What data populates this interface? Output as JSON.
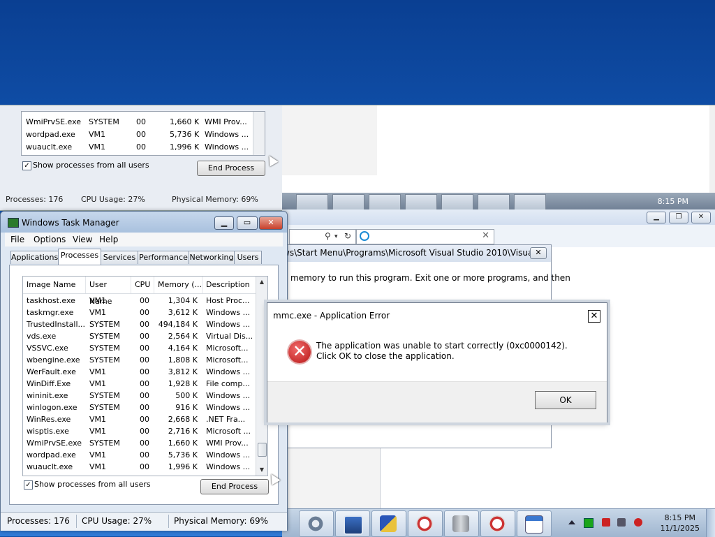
{
  "ghost": {
    "rows": [
      {
        "name": "WmiPrvSE.exe",
        "user": "SYSTEM",
        "cpu": "00",
        "mem": "1,660 K",
        "desc": "WMI Prov..."
      },
      {
        "name": "wordpad.exe",
        "user": "VM1",
        "cpu": "00",
        "mem": "5,736 K",
        "desc": "Windows ..."
      },
      {
        "name": "wuauclt.exe",
        "user": "VM1",
        "cpu": "00",
        "mem": "1,996 K",
        "desc": "Windows ..."
      }
    ],
    "show_all_label": "Show processes from all users",
    "end_process": "End Process",
    "status_processes": "Processes: 176",
    "status_cpu": "CPU Usage: 27%",
    "status_mem": "Physical Memory: 69%",
    "time": "8:15 PM"
  },
  "back_window": {
    "path_text": "ws\\Start Menu\\Programs\\Microsoft Visual Studio 2010\\Visual...",
    "message": "memory to run this program. Exit one or more programs, and then",
    "close": "✕"
  },
  "task_manager": {
    "title": "Windows Task Manager",
    "menu": [
      "File",
      "Options",
      "View",
      "Help"
    ],
    "tabs": [
      "Applications",
      "Processes",
      "Services",
      "Performance",
      "Networking",
      "Users"
    ],
    "active_tab": "Processes",
    "columns": [
      "Image Name",
      "User Name",
      "CPU",
      "Memory (...",
      "Description"
    ],
    "processes": [
      {
        "name": "taskhost.exe",
        "user": "VM1",
        "cpu": "00",
        "mem": "1,304 K",
        "desc": "Host Proc..."
      },
      {
        "name": "taskmgr.exe",
        "user": "VM1",
        "cpu": "00",
        "mem": "3,612 K",
        "desc": "Windows ..."
      },
      {
        "name": "TrustedInstall...",
        "user": "SYSTEM",
        "cpu": "00",
        "mem": "494,184 K",
        "desc": "Windows ..."
      },
      {
        "name": "vds.exe",
        "user": "SYSTEM",
        "cpu": "00",
        "mem": "2,564 K",
        "desc": "Virtual Dis..."
      },
      {
        "name": "VSSVC.exe",
        "user": "SYSTEM",
        "cpu": "00",
        "mem": "4,164 K",
        "desc": "Microsoft..."
      },
      {
        "name": "wbengine.exe",
        "user": "SYSTEM",
        "cpu": "00",
        "mem": "1,808 K",
        "desc": "Microsoft..."
      },
      {
        "name": "WerFault.exe",
        "user": "VM1",
        "cpu": "00",
        "mem": "3,812 K",
        "desc": "Windows ..."
      },
      {
        "name": "WinDiff.Exe",
        "user": "VM1",
        "cpu": "00",
        "mem": "1,928 K",
        "desc": "File comp..."
      },
      {
        "name": "wininit.exe",
        "user": "SYSTEM",
        "cpu": "00",
        "mem": "500 K",
        "desc": "Windows ..."
      },
      {
        "name": "winlogon.exe",
        "user": "SYSTEM",
        "cpu": "00",
        "mem": "916 K",
        "desc": "Windows ..."
      },
      {
        "name": "WinRes.exe",
        "user": "VM1",
        "cpu": "00",
        "mem": "2,668 K",
        "desc": ".NET Fra..."
      },
      {
        "name": "wisptis.exe",
        "user": "VM1",
        "cpu": "00",
        "mem": "2,716 K",
        "desc": "Microsoft ..."
      },
      {
        "name": "WmiPrvSE.exe",
        "user": "SYSTEM",
        "cpu": "00",
        "mem": "1,660 K",
        "desc": "WMI Prov..."
      },
      {
        "name": "wordpad.exe",
        "user": "VM1",
        "cpu": "00",
        "mem": "5,736 K",
        "desc": "Windows ..."
      },
      {
        "name": "wuauclt.exe",
        "user": "VM1",
        "cpu": "00",
        "mem": "1,996 K",
        "desc": "Windows ..."
      }
    ],
    "show_all_label": "Show processes from all users",
    "show_all_checked": "✓",
    "end_process": "End Process",
    "status_processes": "Processes: 176",
    "status_cpu": "CPU Usage: 27%",
    "status_mem": "Physical Memory: 69%"
  },
  "error_dialog": {
    "title": "mmc.exe - Application Error",
    "message": "The application was unable to start correctly (0xc0000142). Click OK to close the application.",
    "ok": "OK",
    "close": "✕",
    "icon": "error-icon"
  },
  "taskbar": {
    "time": "8:15 PM",
    "date": "11/1/2025",
    "buttons": [
      "settings-icon",
      "remote-desktop-icon",
      "security-check-icon",
      "gauge-icon",
      "server-icon",
      "gauge-icon",
      "wordpad-icon"
    ]
  },
  "colors": {
    "desktop": "#1764c6",
    "error_red": "#c62020",
    "title_bar": "#b6cae3"
  }
}
